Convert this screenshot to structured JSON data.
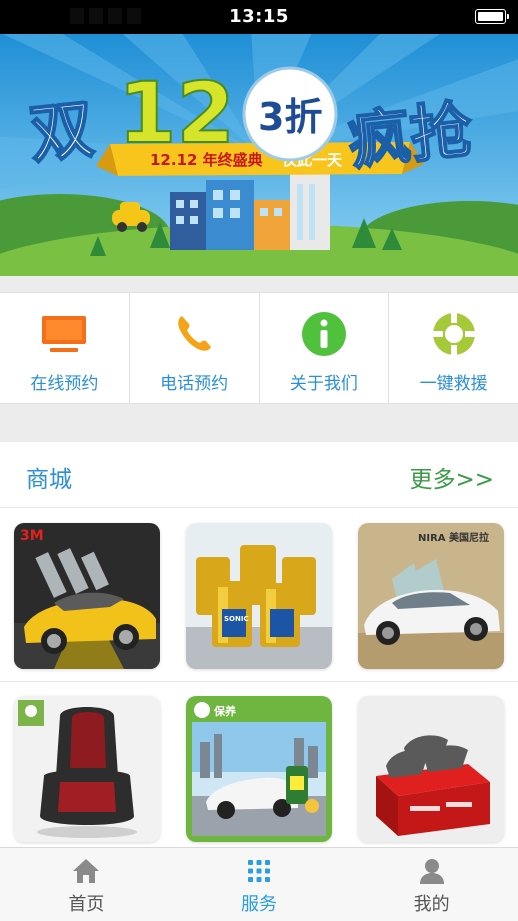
{
  "status_bar": {
    "time": "13:15"
  },
  "banner": {
    "headline_left": "双",
    "headline_num": "12",
    "discount": "3折",
    "headline_right": "疯抢",
    "ribbon_text": "12.12 年终盛典",
    "ribbon_sub": "仅此一天"
  },
  "quick_menu": [
    {
      "label": "在线预约",
      "icon": "tv-icon",
      "color": "#f36f1a"
    },
    {
      "label": "电话预约",
      "icon": "phone-icon",
      "color": "#f5a418"
    },
    {
      "label": "关于我们",
      "icon": "info-icon",
      "color": "#4fc13d"
    },
    {
      "label": "一键救援",
      "icon": "lifebuoy-icon",
      "color": "#a6c93a"
    }
  ],
  "mall": {
    "title": "商城",
    "more": "更多>>",
    "products": [
      {
        "name": "3M window film",
        "brand_text": "3M"
      },
      {
        "name": "SONIC engine oil",
        "brand_text": "SONIC"
      },
      {
        "name": "NIRA car film",
        "brand_text": "NIRA 美国尼拉"
      },
      {
        "name": "child safety seat",
        "brand_text": ""
      },
      {
        "name": "car care products",
        "brand_text": "保养"
      },
      {
        "name": "brake pads",
        "brand_text": ""
      }
    ]
  },
  "tab_bar": [
    {
      "label": "首页",
      "icon": "home-icon",
      "active": false
    },
    {
      "label": "服务",
      "icon": "grid-icon",
      "active": true
    },
    {
      "label": "我的",
      "icon": "user-icon",
      "active": false
    }
  ],
  "colors": {
    "accent": "#2a8fd8",
    "more_green": "#3c9a47",
    "tab_active": "#2a9ee0"
  }
}
